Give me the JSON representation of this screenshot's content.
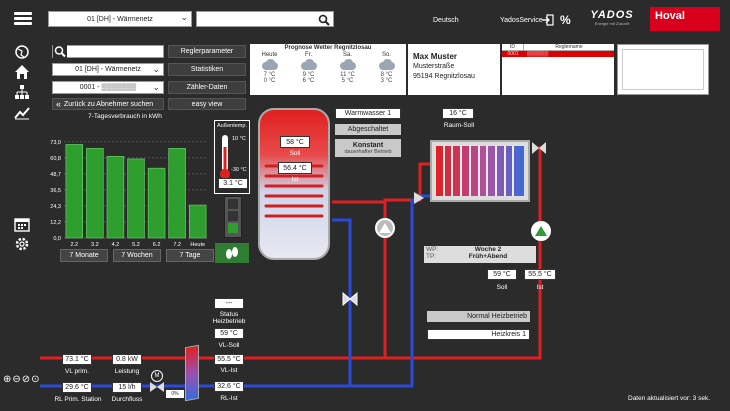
{
  "header": {
    "location_select": "01 [DH] - Wärmenetz",
    "search_value": "",
    "language": "Deutsch",
    "service": "YadosService",
    "brand_yados": "YADOS",
    "brand_yados_sub": "Energie mit Zukunft",
    "brand_hoval": "Hoval"
  },
  "toolbar": {
    "search_value": "",
    "location_select": "01 [DH] - Wärmenetz",
    "consumer_select": "0001 - ▒▒▒▒▒▒▒",
    "reglerparameter": "Reglerparameter",
    "statistiken": "Statistiken",
    "zaehler_daten": "Zähler-Daten",
    "easy_view": "easy view",
    "back_label": "Zurück zu Abnehmer suchen"
  },
  "weather": {
    "title": "Prognose Wetter Regnitzlosau",
    "days": [
      {
        "name": "Heute",
        "high": "7 °C",
        "low": "0 °C"
      },
      {
        "name": "Fr.",
        "high": "9 °C",
        "low": "6 °C"
      },
      {
        "name": "Sa.",
        "high": "11 °C",
        "low": "5 °C"
      },
      {
        "name": "So.",
        "high": "8 °C",
        "low": "3 °C"
      }
    ]
  },
  "address": {
    "name": "Max Muster",
    "street": "Musterstraße",
    "city": "95194 Regnitzlosau"
  },
  "alarm_table": {
    "col_id": "ID",
    "col_name": "Reglername",
    "row_id": "0001",
    "row_name": "▒▒▒▒▒▒"
  },
  "chart_data": {
    "type": "bar",
    "title": "7-Tagesverbrauch in kWh",
    "categories": [
      "2.2",
      "3.2",
      "4.2",
      "5.2",
      "6.2",
      "7.2",
      "Heute"
    ],
    "values": [
      71,
      68,
      62,
      60,
      53,
      68,
      25
    ],
    "ylim": [
      0,
      85
    ],
    "yticks": [
      "73,0",
      "60,8",
      "48,7",
      "36,5",
      "24,3",
      "12,2",
      "0,0"
    ],
    "yticks_values": [
      73.0,
      60.8,
      48.7,
      36.5,
      24.3,
      12.2,
      0.0
    ]
  },
  "period_buttons": [
    "7 Monate",
    "7 Wochen",
    "7 Tage"
  ],
  "outside": {
    "label": "Außentemp.",
    "max": "10 °C",
    "min": "-30 °C",
    "value": "3.1 °C"
  },
  "storage": {
    "soll": "58 °C",
    "soll_label": "Soll",
    "ist": "56.4 °C",
    "ist_label": "Ist",
    "warmwasser": "Warmwasser 1",
    "status": "Abgeschaltet",
    "mode": "Konstant",
    "mode_sub": "dauerhafter Betrieb"
  },
  "room": {
    "soll": "16 °C",
    "label": "Raum-Soll"
  },
  "schedule": {
    "wp_label": "WP:",
    "wp_value": "Woche 2",
    "tp_label": "TP:",
    "tp_value": "Früh+Abend"
  },
  "heating": {
    "soll": "59 °C",
    "soll_label": "Soll",
    "ist": "55.5 °C",
    "ist_label": "Ist",
    "mode": "Normal Heizbetrieb",
    "circuit": "Heizkreis 1"
  },
  "station": {
    "status_value": "---",
    "status_label": "Status Heizbetrieb",
    "vl_soll": "59 °C",
    "vl_soll_label": "VL-Soll",
    "vl_ist": "55.5 °C",
    "vl_ist_label": "VL-Ist",
    "rl_ist": "32.6 °C",
    "rl_ist_label": "RL-Ist",
    "vl_prim": "73.1 °C",
    "vl_prim_label": "VL prim.",
    "leistung": "0.8 kW",
    "leistung_label": "Leistung",
    "rl_prim": "29.6 °C",
    "rl_prim_label": "RL Prim. Station",
    "durchfluss": "15 l/h",
    "durchfluss_label": "Durchfluss",
    "valve": "0%"
  },
  "footer": {
    "updated": "Daten aktualisiert vor: 3 sek."
  },
  "colors": {
    "red": "#e02020",
    "blue": "#2a4ad8",
    "green": "#2e9e2e",
    "hoval": "#d8001c"
  }
}
